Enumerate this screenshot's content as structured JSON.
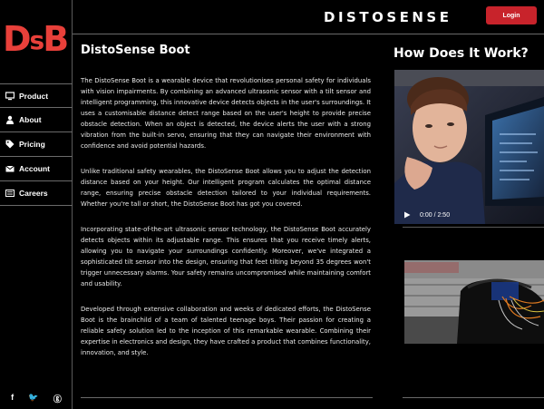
{
  "logo": {
    "part1": "D",
    "part2": "s",
    "part3": "B"
  },
  "header": {
    "brand": "DISTOSENSE",
    "login_label": "Login"
  },
  "sidebar": {
    "items": [
      {
        "label": "Product",
        "icon": "computer-icon"
      },
      {
        "label": "About",
        "icon": "person-icon"
      },
      {
        "label": "Pricing",
        "icon": "tag-icon"
      },
      {
        "label": "Account",
        "icon": "mail-icon"
      },
      {
        "label": "Careers",
        "icon": "list-icon"
      }
    ],
    "social": [
      {
        "label": "f",
        "icon": "facebook-icon"
      },
      {
        "label": "🐦",
        "icon": "twitter-icon"
      },
      {
        "label": "ⓖ",
        "icon": "instagram-icon"
      }
    ]
  },
  "main": {
    "title": "DistoSense Boot",
    "paragraphs": [
      "The DistoSense Boot is a wearable device that revolutionises personal safety for individuals with vision impairments. By combining an advanced ultrasonic sensor with a tilt sensor and intelligent programming, this innovative device detects objects in the user's surroundings. It uses a customisable distance detect range based on the user's height to provide precise obstacle detection. When an object is detected, the device alerts the user with a strong vibration from the built-in servo, ensuring that they can navigate their environment with confidence and avoid potential hazards.",
      "Unlike traditional safety wearables, the DistoSense Boot allows you to adjust the detection distance based on your height. Our intelligent program calculates the optimal distance range, ensuring precise obstacle detection tailored to your individual requirements. Whether you're tall or short, the DistoSense Boot has got you covered.",
      "Incorporating state-of-the-art ultrasonic sensor technology, the DistoSense Boot accurately detects objects within its adjustable range. This ensures that you receive timely alerts, allowing you to navigate your surroundings confidently. Moreover, we've integrated a sophisticated tilt sensor into the design, ensuring that feet tilting beyond 35 degrees won't trigger unnecessary alarms. Your safety remains uncompromised while maintaining comfort and usability.",
      "Developed through extensive collaboration and weeks of dedicated efforts, the DistoSense Boot is the brainchild of a team of talented teenage boys. Their passion for creating a reliable safety solution led to the inception of this remarkable wearable. Combining their expertise in electronics and design, they have crafted a product that combines functionality, innovation, and style."
    ]
  },
  "side": {
    "title": "How Does It Work?",
    "video_time": "0:00 / 2:50"
  },
  "colors": {
    "accent": "#e8403a",
    "button": "#c8232b",
    "background": "#000000"
  }
}
